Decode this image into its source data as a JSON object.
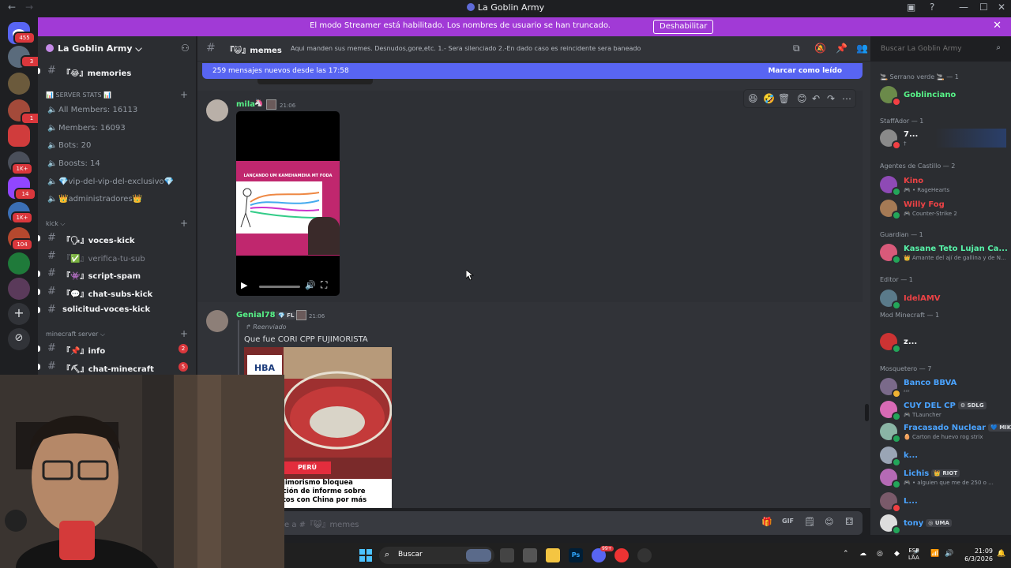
{
  "window": {
    "title": "La Goblin Army",
    "back": "←",
    "forward": "→",
    "controls": [
      "▣",
      "?",
      "—",
      "☐",
      "✕"
    ]
  },
  "banner": {
    "message": "El modo Streamer está habilitado. Los nombres de usuario se han truncado.",
    "button": "Deshabilitar",
    "close": "✕"
  },
  "rail_badges": [
    "455",
    "3",
    "1",
    "1K+",
    "14",
    "1K+",
    "104"
  ],
  "sidebar": {
    "server_name": "La Goblin Army ⌵",
    "top_channel": "『😂』memories",
    "stats_category": "📊 SERVER STATS 📊",
    "stats": [
      "All Members: 16113",
      "Members: 16093",
      "Bots: 20",
      "Boosts: 14",
      "💎vip-del-vip-del-exclusivo💎",
      "👑administradores👑"
    ],
    "kick_category": "kick ⌵",
    "kick_channels": [
      "『🗣』voces-kick",
      "『✅』verifica-tu-sub",
      "『👾』script-spam",
      "『💬』chat-subs-kick",
      "solicitud-voces-kick"
    ],
    "mc_category": "minecraft server ⌵",
    "mc_channels": [
      {
        "label": "『📌』info",
        "count": "2"
      },
      {
        "label": "『⛏』chat-minecraft",
        "count": "5"
      }
    ]
  },
  "header": {
    "channel": "『😺』memes",
    "topic": "Aqui manden sus memes. Desnudos,gore,etc. 1.- Sera silenciado 2.-En dado caso es reincidente sera baneado",
    "search_placeholder": "Buscar La Goblin Army"
  },
  "new_messages": {
    "text": "259 mensajes nuevos desde las 17:58",
    "mark_read": "Marcar como leído"
  },
  "messages": [
    {
      "author": "mila",
      "time": "21:06",
      "video": {
        "caption": "LANÇANDO UM KAMEHAMEHA MT FODA",
        "play": "▶",
        "volume": "🔊",
        "fullscreen": "⛶"
      }
    },
    {
      "author": "Genial789",
      "tag": "FL",
      "time": "21:06",
      "forwarded": "Reenviado",
      "text": "Que fue CORI CPP FUJIMORISTA",
      "image": {
        "logo": "HBA",
        "tag": "PERÚ",
        "headline": "ujimorismo bloquea\nación de informe sobre\natos con China por más"
      }
    }
  ],
  "action_bar": [
    "😆",
    "🤣",
    "🗑",
    "😊",
    "↶",
    "↷",
    "⋯"
  ],
  "composer": {
    "placeholder": "e a #『😺』memes",
    "icons": [
      "🎁",
      "GIF",
      "🗒",
      "😊",
      "⚃"
    ]
  },
  "members": {
    "groups": [
      {
        "role": "🚬 Serrano verde 🚬 — 1",
        "items": [
          {
            "name": "Goblinciano",
            "color": "#57f287"
          }
        ]
      },
      {
        "role": "StaffAdor — 1",
        "items": [
          {
            "name": "7...",
            "status": "†",
            "color": "#f2f3f5"
          }
        ]
      },
      {
        "role": "Agentes de Castillo — 2",
        "items": [
          {
            "name": "Kino",
            "status": "🎮 • RageHearts",
            "color": "#ed4245"
          },
          {
            "name": "Willy Fog",
            "status": "🎮 Counter-Strike 2",
            "color": "#ed4245"
          }
        ]
      },
      {
        "role": "Guardian — 1",
        "items": [
          {
            "name": "Kasane Teto Lujan Ca...",
            "status": "👑 Amante del ají de gallina y de N...",
            "color": "#57f2a8"
          }
        ]
      },
      {
        "role": "Editor — 1",
        "items": [
          {
            "name": "IdelAMV",
            "color": "#ed4245"
          }
        ]
      },
      {
        "role": "Mod Minecraft — 1",
        "items": [
          {
            "name": "z...",
            "color": "#f2f3f5"
          }
        ]
      },
      {
        "role": "Mosquetero — 7",
        "items": [
          {
            "name": "Banco BBVA",
            "status": "ᶻᶻᶻ",
            "color": "#4aa3ff"
          },
          {
            "name": "CUY DEL CP",
            "tag": "SDLG",
            "status": "🎮 TLauncher",
            "color": "#4aa3ff"
          },
          {
            "name": "Fracasado Nuclear",
            "tag": "MIKU",
            "status": "🥚 Carton de huevo rog strix",
            "color": "#4aa3ff"
          },
          {
            "name": "k...",
            "color": "#4aa3ff"
          },
          {
            "name": "Lichis",
            "tag": "RIOT",
            "status": "🎮 • alguien que me de 250 o ...",
            "color": "#4aa3ff"
          },
          {
            "name": "L...",
            "color": "#4aa3ff"
          },
          {
            "name": "tony",
            "tag": "UMA",
            "color": "#4aa3ff"
          }
        ]
      }
    ]
  },
  "taskbar": {
    "search": "Buscar",
    "lang": "ESP",
    "lang2": "LAA",
    "time": "21:09",
    "date": "6/3/2026",
    "discord_badge": "99+"
  },
  "colors": {
    "accent": "#5865f2",
    "banner": "#a13ad6",
    "online": "#23a559",
    "dnd": "#f23f43",
    "idle": "#f0b232"
  }
}
